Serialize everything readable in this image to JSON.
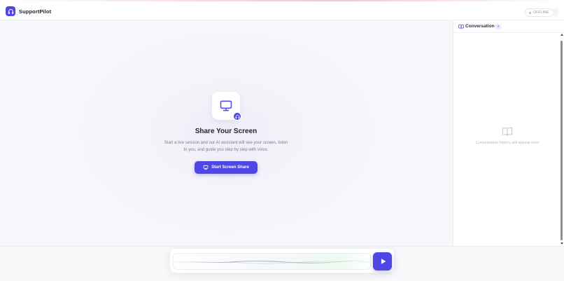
{
  "app": {
    "name": "SupportPilot",
    "logo_icon": "headset-icon",
    "status": "OFFLINE"
  },
  "colors": {
    "accent": "#4f46e5",
    "background": "#f6f7fa",
    "muted_text": "#7b8191"
  },
  "hero": {
    "icon": "monitor-icon",
    "badge_icon": "headset-icon",
    "title": "Share Your Screen",
    "description": "Start a live session and our AI assistant will see your screen, listen to you, and guide you step by step with voice.",
    "cta_label": "Start Screen Share",
    "cta_icon": "monitor-icon"
  },
  "sidebar": {
    "title": "Conversation",
    "count": "0",
    "header_icon": "book-open-icon",
    "empty_icon": "book-open-icon",
    "empty_text": "Conversation history will appear here"
  },
  "voice_bar": {
    "waveform_icon": "waveform-line",
    "play_icon": "play-icon"
  }
}
